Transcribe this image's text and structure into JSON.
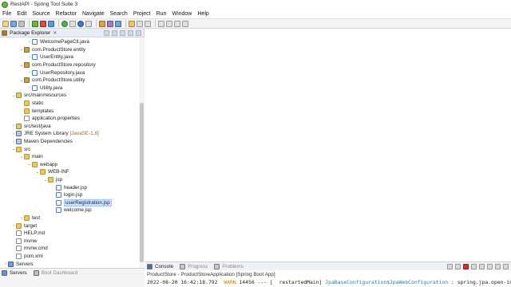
{
  "window": {
    "title": "RestAPI - Spring Tool Suite 3"
  },
  "menu": [
    "File",
    "Edit",
    "Source",
    "Refactor",
    "Navigate",
    "Search",
    "Project",
    "Run",
    "Window",
    "Help"
  ],
  "explorer": {
    "title": "Package Explorer",
    "close": "✕"
  },
  "tree": [
    {
      "label": "WelcomePageCtl.java",
      "level": 3,
      "icon": "java-file-icon",
      "twisty": "›"
    },
    {
      "label": "com.ProductStore.entity",
      "level": 2,
      "icon": "package-icon",
      "twisty": "⌄"
    },
    {
      "label": "UserEntity.java",
      "level": 3,
      "icon": "java-file-icon",
      "twisty": "›"
    },
    {
      "label": "com.ProductStore.repository",
      "level": 2,
      "icon": "package-icon",
      "twisty": "⌄"
    },
    {
      "label": "UserRepository.java",
      "level": 3,
      "icon": "java-file-icon",
      "twisty": "›"
    },
    {
      "label": "com.ProductStore.utility",
      "level": 2,
      "icon": "package-icon",
      "twisty": "⌄"
    },
    {
      "label": "Utility.java",
      "level": 3,
      "icon": "java-file-icon",
      "twisty": "›"
    },
    {
      "label": "src/main/resources",
      "level": 1,
      "icon": "source-folder-icon",
      "twisty": "⌄"
    },
    {
      "label": "static",
      "level": 2,
      "icon": "folder-icon",
      "twisty": ""
    },
    {
      "label": "templates",
      "level": 2,
      "icon": "folder-icon",
      "twisty": ""
    },
    {
      "label": "application.properties",
      "level": 2,
      "icon": "file-icon",
      "twisty": ""
    },
    {
      "label": "src/test/java",
      "level": 1,
      "icon": "source-folder-icon",
      "twisty": "›"
    },
    {
      "label": "JRE System Library",
      "level": 1,
      "icon": "library-icon",
      "twisty": "›",
      "deco": "[JavaSE-1.8]"
    },
    {
      "label": "Maven Dependencies",
      "level": 1,
      "icon": "library-icon",
      "twisty": "›"
    },
    {
      "label": "src",
      "level": 1,
      "icon": "folder-icon",
      "twisty": "⌄"
    },
    {
      "label": "main",
      "level": 2,
      "icon": "folder-icon",
      "twisty": "⌄"
    },
    {
      "label": "webapp",
      "level": 3,
      "icon": "folder-icon",
      "twisty": "⌄"
    },
    {
      "label": "WEB-INF",
      "level": 4,
      "icon": "folder-icon",
      "twisty": "⌄"
    },
    {
      "label": "jsp",
      "level": 5,
      "icon": "folder-icon",
      "twisty": "⌄"
    },
    {
      "label": "header.jsp",
      "level": 6,
      "icon": "jsp-file-icon",
      "twisty": ""
    },
    {
      "label": "login.jsp",
      "level": 6,
      "icon": "jsp-file-icon",
      "twisty": ""
    },
    {
      "label": "userRegistration.jsp",
      "level": 6,
      "icon": "jsp-file-icon",
      "twisty": "",
      "selected": true
    },
    {
      "label": "welcome.jsp",
      "level": 6,
      "icon": "jsp-file-icon",
      "twisty": ""
    },
    {
      "label": "test",
      "level": 2,
      "icon": "folder-icon",
      "twisty": "›"
    },
    {
      "label": "target",
      "level": 1,
      "icon": "folder-icon",
      "twisty": "›"
    },
    {
      "label": "HELP.md",
      "level": 1,
      "icon": "file-icon",
      "twisty": ""
    },
    {
      "label": "mvnw",
      "level": 1,
      "icon": "file-icon",
      "twisty": ""
    },
    {
      "label": "mvnw.cmd",
      "level": 1,
      "icon": "file-icon",
      "twisty": ""
    },
    {
      "label": "pom.xml",
      "level": 1,
      "icon": "file-icon",
      "twisty": ""
    },
    {
      "label": "Servers",
      "level": 0,
      "icon": "project-icon",
      "twisty": "›"
    }
  ],
  "bottom_left_tabs": [
    {
      "label": "Servers",
      "icon": "servers-icon",
      "active": true
    },
    {
      "label": "Boot Dashboard",
      "icon": "boot-dashboard-icon",
      "active": false
    }
  ],
  "console": {
    "tabs": [
      {
        "label": "Console",
        "icon": "console-icon",
        "active": true
      },
      {
        "label": "Progress",
        "icon": "progress-icon",
        "active": false
      },
      {
        "label": "Problems",
        "icon": "problems-icon",
        "active": false
      }
    ],
    "launch": "ProductStore - ProductStoreApplication [Spring Boot App]",
    "log": {
      "timestamp": "2022-08-20 16:42:18.792",
      "level": "WARN",
      "pid": "14456",
      "sep": "--- [",
      "thread": "restartedMain]",
      "logger": "JpaBaseConfiguration$JpaWebConfiguration",
      "message": ": spring.jpa.open-in-v"
    }
  },
  "colors": {
    "accent": "#6db33f",
    "selection": "#cfe2ff",
    "warn": "#c08a00"
  }
}
